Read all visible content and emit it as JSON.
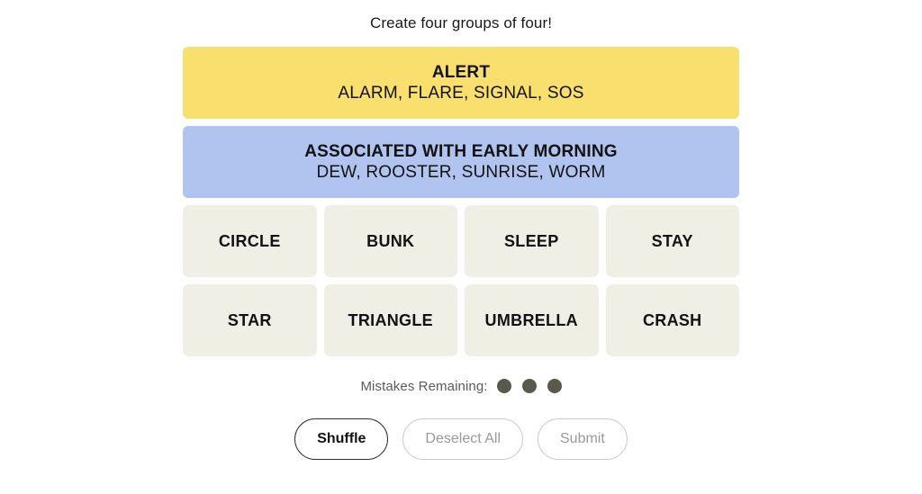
{
  "header": {
    "instruction": "Create four groups of four!"
  },
  "colors": {
    "page_background": "#ffffff",
    "group_yellow": "#f9df6d",
    "group_blue": "#b0c4ef",
    "tile_background": "#efefe6",
    "tile_text": "#121212",
    "mistake_dot": "#5a594e",
    "mistakes_label": "#5b5b5b",
    "button_active_border": "#2f2f2f",
    "button_disabled_border": "#cccccc",
    "button_disabled_text": "#9a9a9a"
  },
  "board": {
    "solved_groups": [
      {
        "title": "ALERT",
        "members": "ALARM, FLARE, SIGNAL, SOS",
        "color": "#f9df6d",
        "color_name": "yellow"
      },
      {
        "title": "ASSOCIATED WITH EARLY MORNING",
        "members": "DEW, ROOSTER, SUNRISE, WORM",
        "color": "#b0c4ef",
        "color_name": "blue"
      }
    ],
    "tile_rows": [
      [
        "CIRCLE",
        "BUNK",
        "SLEEP",
        "STAY"
      ],
      [
        "STAR",
        "TRIANGLE",
        "UMBRELLA",
        "CRASH"
      ]
    ]
  },
  "mistakes": {
    "label": "Mistakes Remaining:",
    "remaining": 3,
    "dots": [
      "dot",
      "dot",
      "dot"
    ]
  },
  "actions": {
    "shuffle_label": "Shuffle",
    "deselect_label": "Deselect All",
    "submit_label": "Submit"
  }
}
